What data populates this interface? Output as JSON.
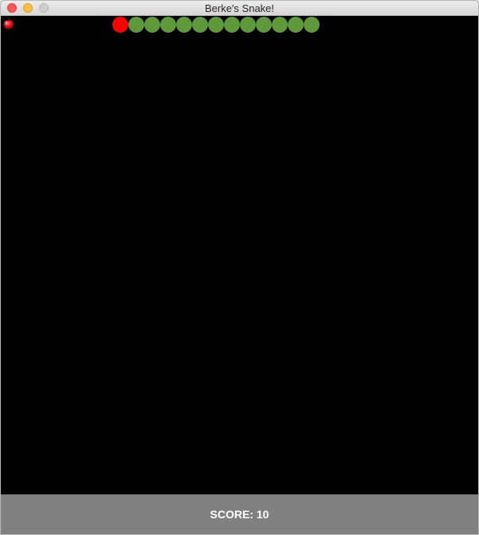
{
  "window": {
    "title": "Berke's Snake!"
  },
  "game": {
    "apple_icon": "apple-icon",
    "snake": {
      "head_color": "#ff0000",
      "body_color": "#5f9a3a",
      "length": 13
    },
    "board_color": "#000000"
  },
  "status": {
    "score_text": "SCORE: 10",
    "bar_color": "#808080"
  }
}
